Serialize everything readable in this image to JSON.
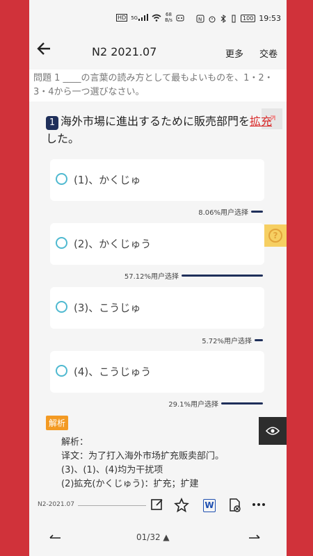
{
  "status_bar": {
    "hd": "HD",
    "signal": "5G",
    "net_speed_value": "68",
    "net_speed_unit": "B/s",
    "battery": "100",
    "time": "19:53"
  },
  "header": {
    "title": "N2 2021.07",
    "more_label": "更多",
    "submit_label": "交卷"
  },
  "instruction": "問題 1 ____の言葉の読み方として最もよいものを、1・2・3・4から一つ選びなさい。",
  "question": {
    "number": "1",
    "text_before": "海外市場に進出するために販売部門を",
    "highlight": "拡充",
    "text_after": "した。"
  },
  "options": [
    {
      "label": "(1)、かくじゅ",
      "stat": "8.06%用户选择",
      "percent": 8.06
    },
    {
      "label": "(2)、かくじゅう",
      "stat": "57.12%用户选择",
      "percent": 57.12
    },
    {
      "label": "(3)、こうじゅ",
      "stat": "5.72%用户选择",
      "percent": 5.72
    },
    {
      "label": "(4)、こうじゅう",
      "stat": "29.1%用户选择",
      "percent": 29.1
    }
  ],
  "help_symbol": "?",
  "analysis": {
    "tag": "解析",
    "lines": [
      "解析：",
      "译文：为了打入海外市场扩充贩卖部门。",
      "(3)、(1)、(4)均为干扰项",
      "(2)拡充(かくじゅう)：扩充；扩建"
    ]
  },
  "toolbar": {
    "paper_id": "N2-2021.07",
    "word_label": "W"
  },
  "bottom_nav": {
    "page_indicator": "01/32 ▲"
  },
  "icons": [
    "back-arrow-icon",
    "share-icon",
    "help-icon",
    "eye-icon",
    "edit-note-icon",
    "star-icon",
    "word-export-icon",
    "error-report-icon",
    "more-icon",
    "prev-icon",
    "next-icon"
  ],
  "colors": {
    "accent_navy": "#1f2f5a",
    "radio_teal": "#4fb9d0",
    "highlight_red": "#d92c2c",
    "analysis_orange": "#f39a23",
    "help_yellow": "#f6cf62",
    "frame_red": "#d0323a"
  }
}
